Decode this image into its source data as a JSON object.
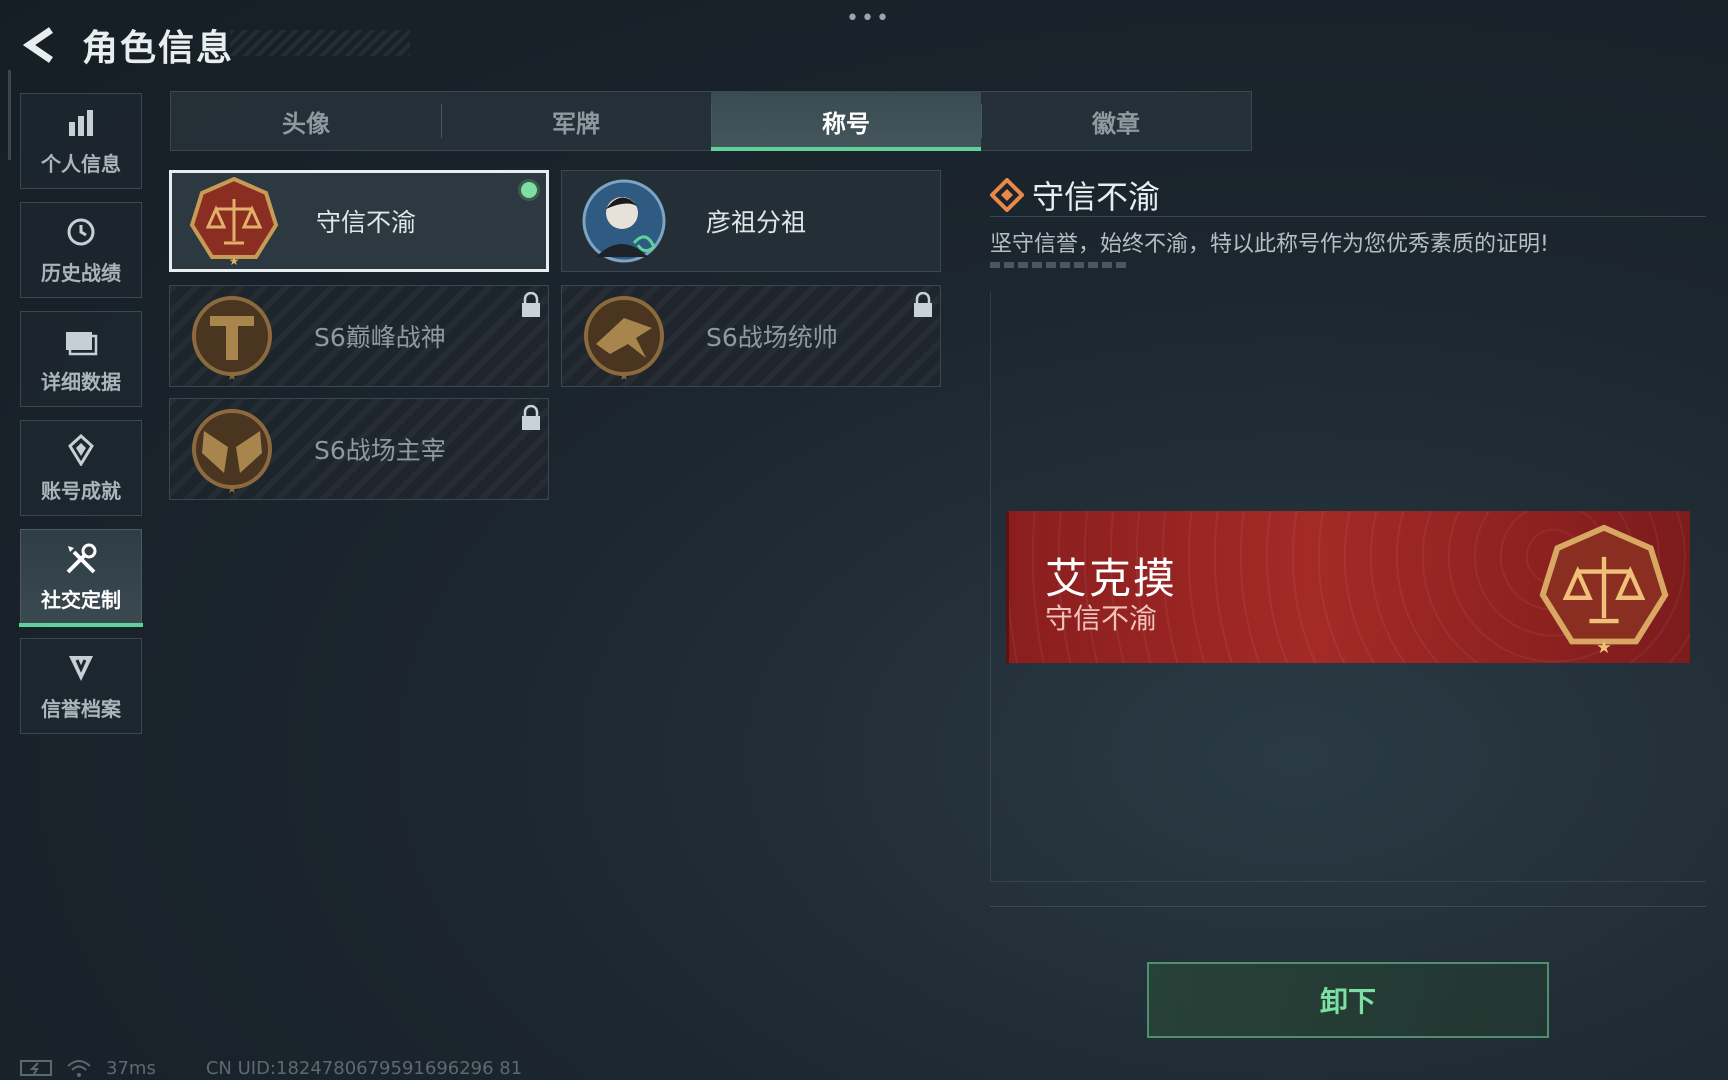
{
  "header": {
    "title": "角色信息"
  },
  "sidebar": {
    "items": [
      {
        "label": "个人信息",
        "icon": "bar-chart-icon"
      },
      {
        "label": "历史战绩",
        "icon": "history-icon"
      },
      {
        "label": "详细数据",
        "icon": "folder-icon"
      },
      {
        "label": "账号成就",
        "icon": "achievement-icon"
      },
      {
        "label": "社交定制",
        "icon": "tools-icon",
        "active": true
      },
      {
        "label": "信誉档案",
        "icon": "credit-shield-icon"
      }
    ]
  },
  "tabs": [
    {
      "label": "头像"
    },
    {
      "label": "军牌"
    },
    {
      "label": "称号",
      "active": true
    },
    {
      "label": "徽章"
    }
  ],
  "titles": [
    {
      "name": "守信不渝",
      "badge": "scales-badge-icon",
      "selected": true,
      "equipped": true,
      "locked": false
    },
    {
      "name": "彦祖分祖",
      "badge": "portrait-badge-icon",
      "selected": false,
      "equipped": false,
      "locked": false
    },
    {
      "name": "S6巅峰战神",
      "badge": "t-crest-badge-icon",
      "selected": false,
      "equipped": false,
      "locked": true
    },
    {
      "name": "S6战场统帅",
      "badge": "jet-badge-icon",
      "selected": false,
      "equipped": false,
      "locked": true
    },
    {
      "name": "S6战场主宰",
      "badge": "wings-badge-icon",
      "selected": false,
      "equipped": false,
      "locked": true
    }
  ],
  "detail": {
    "title": "守信不渝",
    "description": "坚守信誉，始终不渝，特以此称号作为您优秀素质的证明!"
  },
  "preview": {
    "player_name": "艾克摸",
    "player_title": "守信不渝"
  },
  "actions": {
    "unequip_label": "卸下"
  },
  "status": {
    "ping": "37ms",
    "uid": "CN UID:1824780679591696296 81"
  },
  "colors": {
    "accent": "#5fd19a",
    "banner_red": "#a42a26",
    "gold": "#c79a55"
  }
}
